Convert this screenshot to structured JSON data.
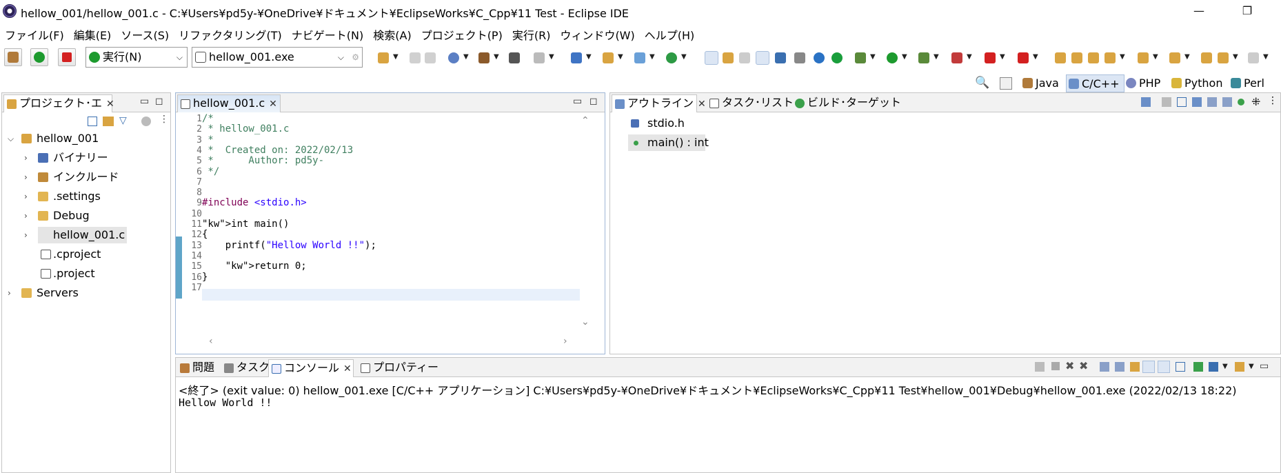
{
  "window": {
    "title": "hellow_001/hellow_001.c - C:¥Users¥pd5y-¥OneDrive¥ドキュメント¥EclipseWorks¥C_Cpp¥11 Test - Eclipse IDE",
    "minimize": "—",
    "restore": "❐"
  },
  "menu": [
    "ファイル(F)",
    "編集(E)",
    "ソース(S)",
    "リファクタリング(T)",
    "ナビゲート(N)",
    "検索(A)",
    "プロジェクト(P)",
    "実行(R)",
    "ウィンドウ(W)",
    "ヘルプ(H)"
  ],
  "toolbar": {
    "run_mode": "実行(N)",
    "launch_config": "hellow_001.exe"
  },
  "perspectives": [
    "Java",
    "C/C++",
    "PHP",
    "Python",
    "Perl"
  ],
  "project_explorer": {
    "tab_label": "プロジェクト･エ",
    "items": [
      {
        "label": "hellow_001",
        "level": 0,
        "expanded": true
      },
      {
        "label": "バイナリー",
        "level": 1
      },
      {
        "label": "インクルード",
        "level": 1
      },
      {
        "label": ".settings",
        "level": 1
      },
      {
        "label": "Debug",
        "level": 1
      },
      {
        "label": "hellow_001.c",
        "level": 1,
        "selected": true
      },
      {
        "label": ".cproject",
        "level": 1
      },
      {
        "label": ".project",
        "level": 1
      },
      {
        "label": "Servers",
        "level": 0
      }
    ]
  },
  "editor": {
    "tab_label": "hellow_001.c",
    "lines": [
      {
        "n": "1",
        "text": "/*"
      },
      {
        "n": "2",
        "text": " * hellow_001.c"
      },
      {
        "n": "3",
        "text": " *"
      },
      {
        "n": "4",
        "text": " *  Created on: 2022/02/13"
      },
      {
        "n": "5",
        "text": " *      Author: pd5y-"
      },
      {
        "n": "6",
        "text": " */"
      },
      {
        "n": "7",
        "text": ""
      },
      {
        "n": "8",
        "text": ""
      },
      {
        "n": "9",
        "text": "#include <stdio.h>"
      },
      {
        "n": "10",
        "text": ""
      },
      {
        "n": "11",
        "text": "int main()"
      },
      {
        "n": "12",
        "text": "{"
      },
      {
        "n": "13",
        "text": "    printf(\"Hellow World !!\");"
      },
      {
        "n": "14",
        "text": ""
      },
      {
        "n": "15",
        "text": "    return 0;"
      },
      {
        "n": "16",
        "text": "}"
      },
      {
        "n": "17",
        "text": ""
      }
    ]
  },
  "outline": {
    "tabs": [
      "アウトライン",
      "タスク･リスト",
      "ビルド･ターゲット"
    ],
    "items": [
      "stdio.h",
      "main() : int"
    ]
  },
  "bottom": {
    "tabs": [
      "問題",
      "タスク",
      "コンソール",
      "プロパティー"
    ],
    "console_header": "<終了> (exit value: 0) hellow_001.exe [C/C++ アプリケーション] C:¥Users¥pd5y-¥OneDrive¥ドキュメント¥EclipseWorks¥C_Cpp¥11 Test¥hellow_001¥Debug¥hellow_001.exe (2022/02/13 18:22)",
    "console_output": "Hellow World !!"
  },
  "colors": {
    "comment": "#3f7f5f",
    "keyword": "#7f0055",
    "string": "#2a00ff",
    "active_tab": "#d8e5f5"
  }
}
